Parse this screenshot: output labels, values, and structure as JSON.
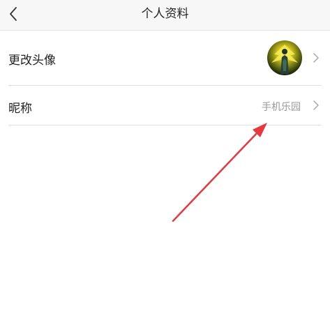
{
  "header": {
    "title": "个人资料",
    "back_icon": "chevron-left-icon"
  },
  "rows": {
    "avatar": {
      "label": "更改头像",
      "chevron_icon": "chevron-right-icon"
    },
    "nickname": {
      "label": "昵称",
      "value": "手机乐园",
      "chevron_icon": "chevron-right-icon"
    }
  },
  "colors": {
    "annotation_arrow": "#e8373f",
    "secondary_text": "#999999",
    "divider": "#e0e0e0",
    "header_background": "#f7f7f7"
  }
}
